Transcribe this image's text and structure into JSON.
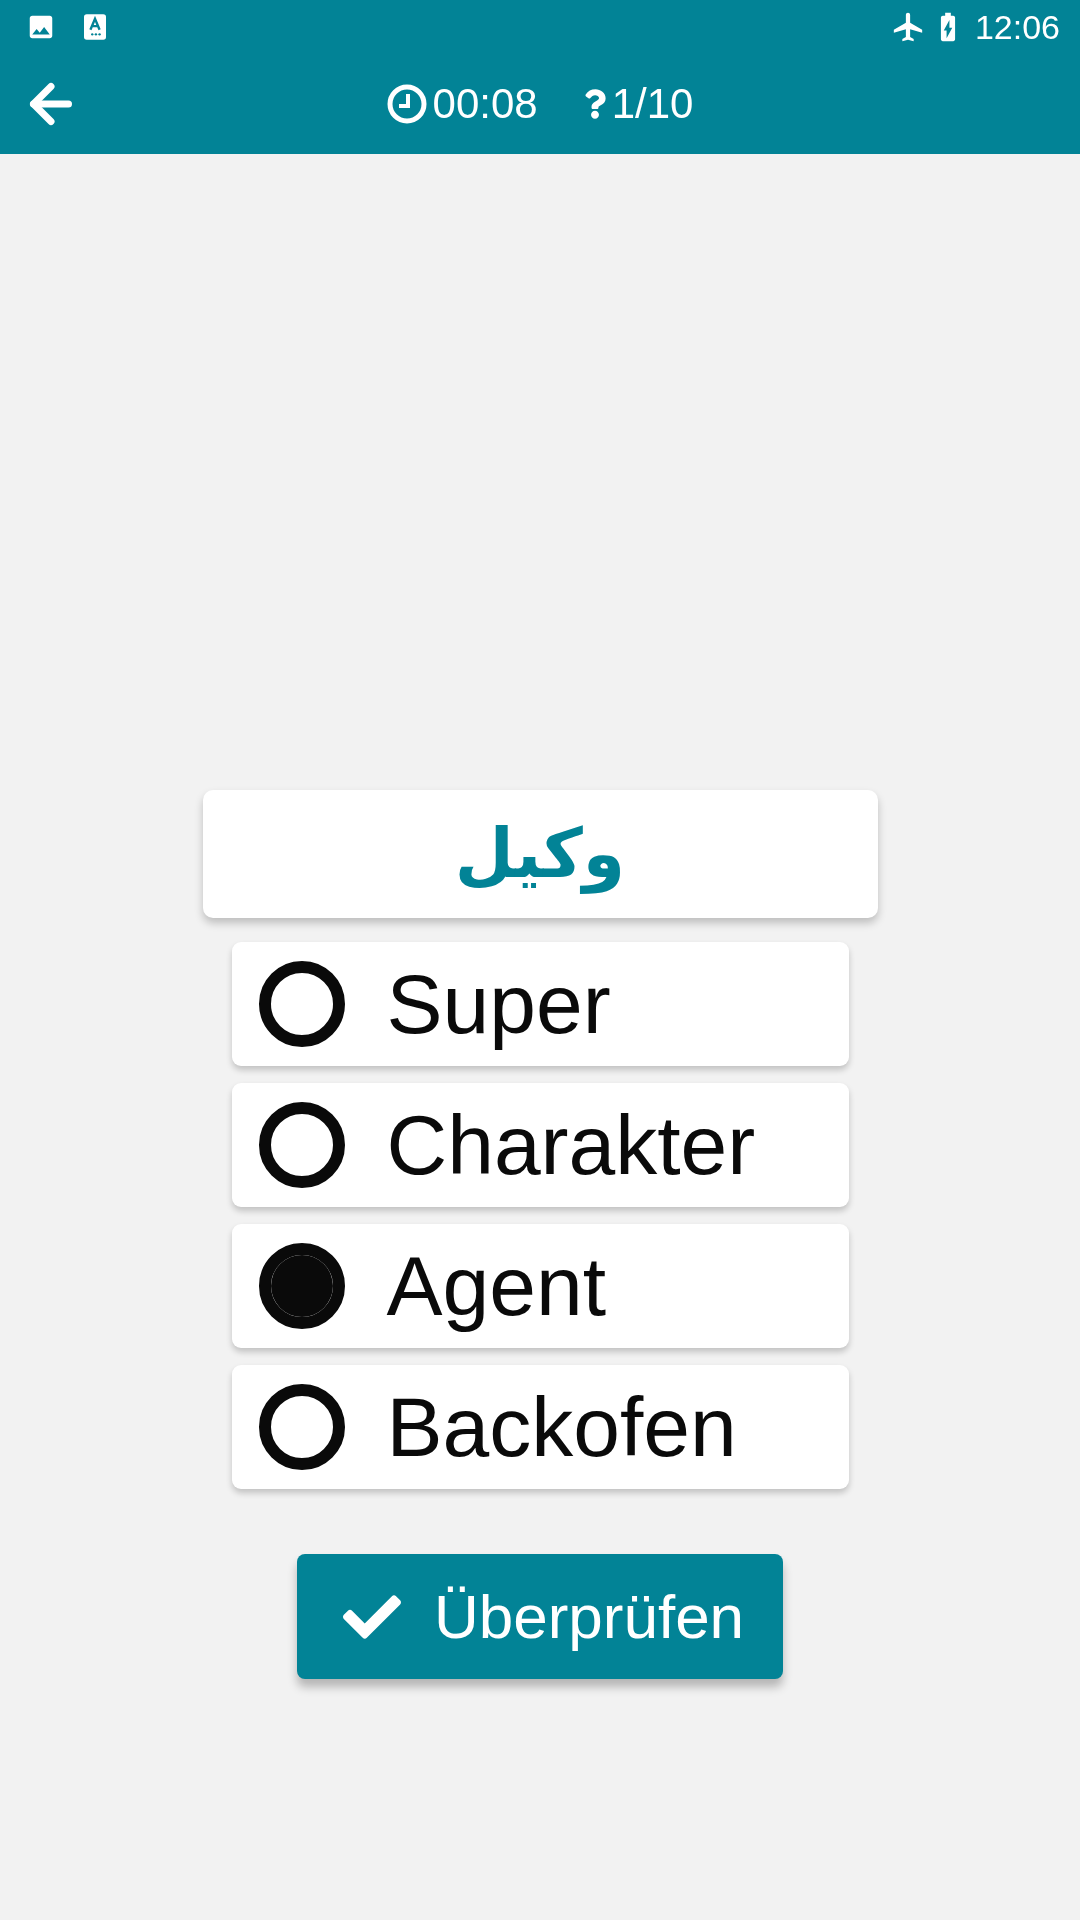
{
  "status_bar": {
    "time": "12:06"
  },
  "toolbar": {
    "timer": "00:08",
    "question_count": "1/10"
  },
  "question": {
    "word": "وكيل"
  },
  "options": [
    {
      "label": "Super",
      "selected": false
    },
    {
      "label": "Charakter",
      "selected": false
    },
    {
      "label": "Agent",
      "selected": true
    },
    {
      "label": "Backofen",
      "selected": false
    }
  ],
  "check_button": {
    "label": "Überprüfen"
  }
}
